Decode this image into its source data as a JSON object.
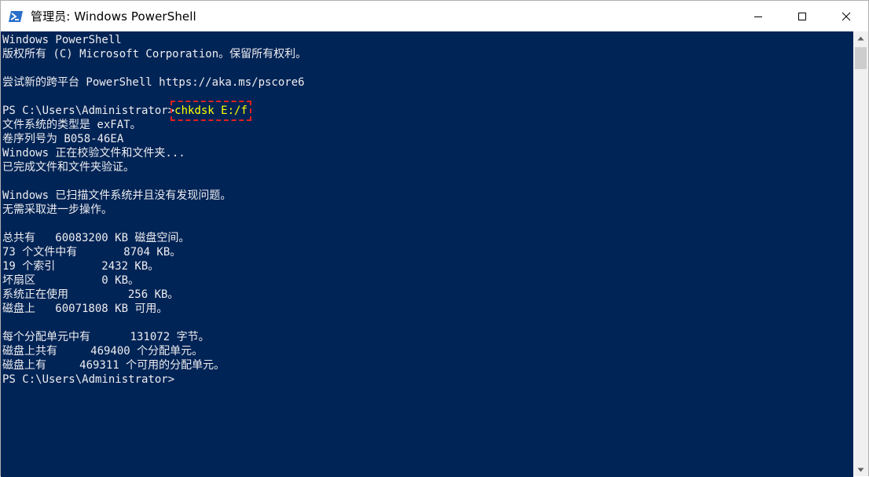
{
  "window": {
    "title": "管理员: Windows PowerShell",
    "icon": "powershell-icon",
    "controls": [
      "minimize-icon",
      "maximize-icon",
      "close-icon"
    ]
  },
  "colors": {
    "terminal_bg": "#012456",
    "text": "#eeedf0",
    "command": "#ffff00",
    "highlight_box": "#e02020"
  },
  "terminal": {
    "banner_1": "Windows PowerShell",
    "banner_2": "版权所有 (C) Microsoft Corporation。保留所有权利。",
    "banner_3": "尝试新的跨平台 PowerShell https://aka.ms/pscore6",
    "prompt": "PS C:\\Users\\Administrator>",
    "command": "chkdsk E:/f",
    "output": [
      "文件系统的类型是 exFAT。",
      "卷序列号为 B058-46EA",
      "Windows 正在校验文件和文件夹...",
      "已完成文件和文件夹验证。",
      "",
      "Windows 已扫描文件系统并且没有发现问题。",
      "无需采取进一步操作。",
      "",
      "总共有   60083200 KB 磁盘空间。",
      "73 个文件中有       8704 KB。",
      "19 个索引       2432 KB。",
      "坏扇区          0 KB。",
      "系统正在使用         256 KB。",
      "磁盘上   60071808 KB 可用。",
      "",
      "每个分配单元中有      131072 字节。",
      "磁盘上共有     469400 个分配单元。",
      "磁盘上有     469311 个可用的分配单元。"
    ],
    "final_prompt": "PS C:\\Users\\Administrator>"
  }
}
